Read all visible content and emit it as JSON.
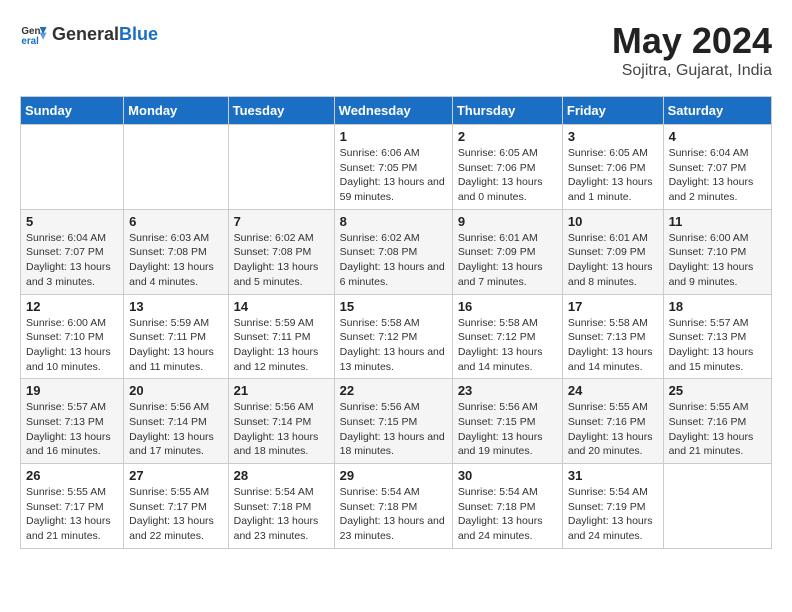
{
  "header": {
    "logo_general": "General",
    "logo_blue": "Blue",
    "title": "May 2024",
    "subtitle": "Sojitra, Gujarat, India"
  },
  "calendar": {
    "weekdays": [
      "Sunday",
      "Monday",
      "Tuesday",
      "Wednesday",
      "Thursday",
      "Friday",
      "Saturday"
    ],
    "weeks": [
      [
        {
          "day": "",
          "info": ""
        },
        {
          "day": "",
          "info": ""
        },
        {
          "day": "",
          "info": ""
        },
        {
          "day": "1",
          "info": "Sunrise: 6:06 AM\nSunset: 7:05 PM\nDaylight: 13 hours and 59 minutes."
        },
        {
          "day": "2",
          "info": "Sunrise: 6:05 AM\nSunset: 7:06 PM\nDaylight: 13 hours and 0 minutes."
        },
        {
          "day": "3",
          "info": "Sunrise: 6:05 AM\nSunset: 7:06 PM\nDaylight: 13 hours and 1 minute."
        },
        {
          "day": "4",
          "info": "Sunrise: 6:04 AM\nSunset: 7:07 PM\nDaylight: 13 hours and 2 minutes."
        }
      ],
      [
        {
          "day": "5",
          "info": "Sunrise: 6:04 AM\nSunset: 7:07 PM\nDaylight: 13 hours and 3 minutes."
        },
        {
          "day": "6",
          "info": "Sunrise: 6:03 AM\nSunset: 7:08 PM\nDaylight: 13 hours and 4 minutes."
        },
        {
          "day": "7",
          "info": "Sunrise: 6:02 AM\nSunset: 7:08 PM\nDaylight: 13 hours and 5 minutes."
        },
        {
          "day": "8",
          "info": "Sunrise: 6:02 AM\nSunset: 7:08 PM\nDaylight: 13 hours and 6 minutes."
        },
        {
          "day": "9",
          "info": "Sunrise: 6:01 AM\nSunset: 7:09 PM\nDaylight: 13 hours and 7 minutes."
        },
        {
          "day": "10",
          "info": "Sunrise: 6:01 AM\nSunset: 7:09 PM\nDaylight: 13 hours and 8 minutes."
        },
        {
          "day": "11",
          "info": "Sunrise: 6:00 AM\nSunset: 7:10 PM\nDaylight: 13 hours and 9 minutes."
        }
      ],
      [
        {
          "day": "12",
          "info": "Sunrise: 6:00 AM\nSunset: 7:10 PM\nDaylight: 13 hours and 10 minutes."
        },
        {
          "day": "13",
          "info": "Sunrise: 5:59 AM\nSunset: 7:11 PM\nDaylight: 13 hours and 11 minutes."
        },
        {
          "day": "14",
          "info": "Sunrise: 5:59 AM\nSunset: 7:11 PM\nDaylight: 13 hours and 12 minutes."
        },
        {
          "day": "15",
          "info": "Sunrise: 5:58 AM\nSunset: 7:12 PM\nDaylight: 13 hours and 13 minutes."
        },
        {
          "day": "16",
          "info": "Sunrise: 5:58 AM\nSunset: 7:12 PM\nDaylight: 13 hours and 14 minutes."
        },
        {
          "day": "17",
          "info": "Sunrise: 5:58 AM\nSunset: 7:13 PM\nDaylight: 13 hours and 14 minutes."
        },
        {
          "day": "18",
          "info": "Sunrise: 5:57 AM\nSunset: 7:13 PM\nDaylight: 13 hours and 15 minutes."
        }
      ],
      [
        {
          "day": "19",
          "info": "Sunrise: 5:57 AM\nSunset: 7:13 PM\nDaylight: 13 hours and 16 minutes."
        },
        {
          "day": "20",
          "info": "Sunrise: 5:56 AM\nSunset: 7:14 PM\nDaylight: 13 hours and 17 minutes."
        },
        {
          "day": "21",
          "info": "Sunrise: 5:56 AM\nSunset: 7:14 PM\nDaylight: 13 hours and 18 minutes."
        },
        {
          "day": "22",
          "info": "Sunrise: 5:56 AM\nSunset: 7:15 PM\nDaylight: 13 hours and 18 minutes."
        },
        {
          "day": "23",
          "info": "Sunrise: 5:56 AM\nSunset: 7:15 PM\nDaylight: 13 hours and 19 minutes."
        },
        {
          "day": "24",
          "info": "Sunrise: 5:55 AM\nSunset: 7:16 PM\nDaylight: 13 hours and 20 minutes."
        },
        {
          "day": "25",
          "info": "Sunrise: 5:55 AM\nSunset: 7:16 PM\nDaylight: 13 hours and 21 minutes."
        }
      ],
      [
        {
          "day": "26",
          "info": "Sunrise: 5:55 AM\nSunset: 7:17 PM\nDaylight: 13 hours and 21 minutes."
        },
        {
          "day": "27",
          "info": "Sunrise: 5:55 AM\nSunset: 7:17 PM\nDaylight: 13 hours and 22 minutes."
        },
        {
          "day": "28",
          "info": "Sunrise: 5:54 AM\nSunset: 7:18 PM\nDaylight: 13 hours and 23 minutes."
        },
        {
          "day": "29",
          "info": "Sunrise: 5:54 AM\nSunset: 7:18 PM\nDaylight: 13 hours and 23 minutes."
        },
        {
          "day": "30",
          "info": "Sunrise: 5:54 AM\nSunset: 7:18 PM\nDaylight: 13 hours and 24 minutes."
        },
        {
          "day": "31",
          "info": "Sunrise: 5:54 AM\nSunset: 7:19 PM\nDaylight: 13 hours and 24 minutes."
        },
        {
          "day": "",
          "info": ""
        }
      ]
    ]
  }
}
